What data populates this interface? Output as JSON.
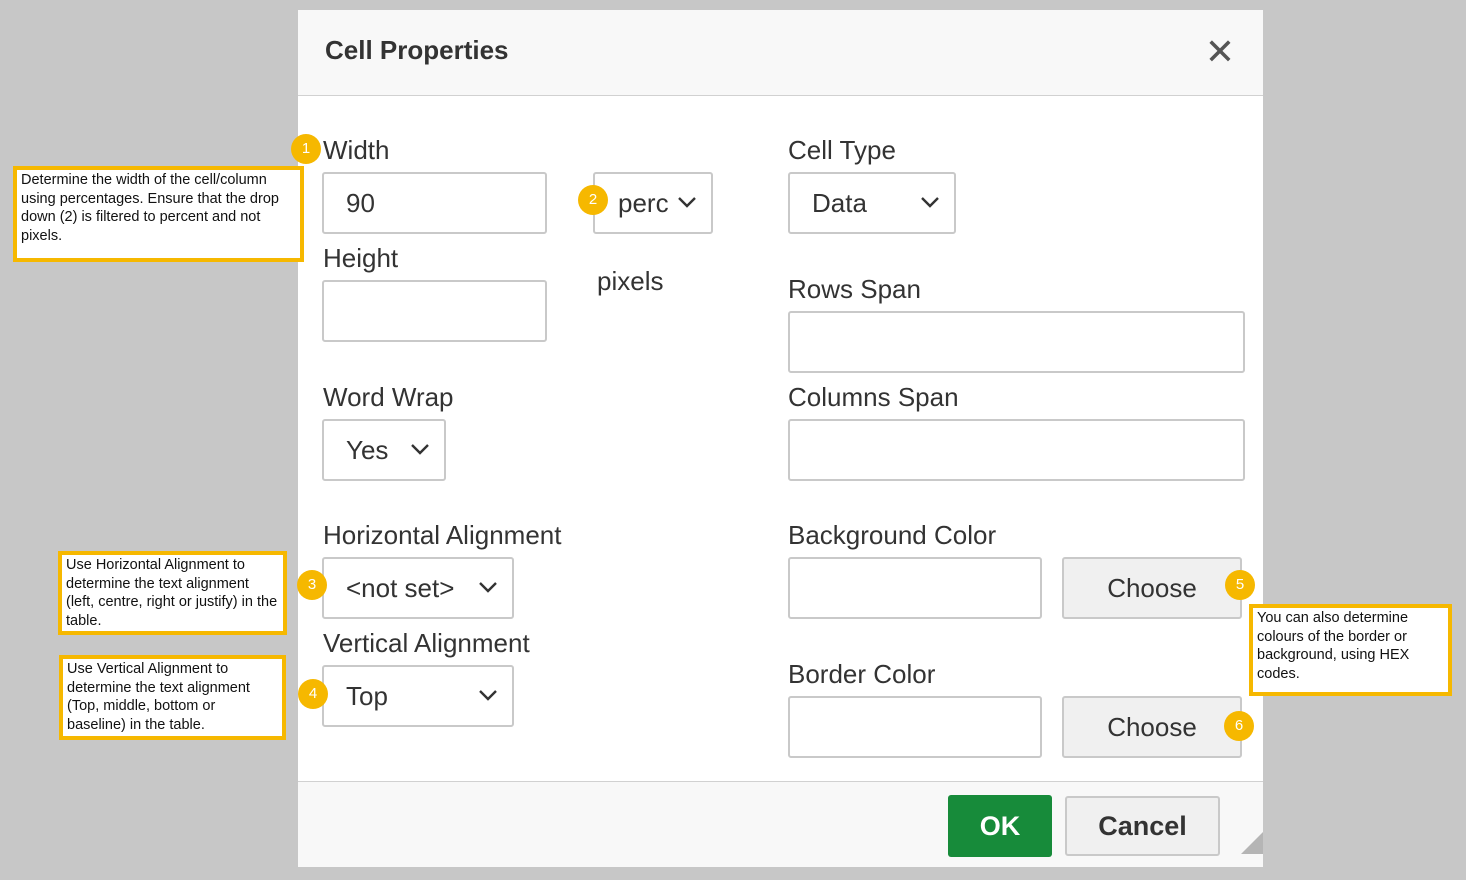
{
  "dialog": {
    "title": "Cell Properties",
    "close_glyph": "✕"
  },
  "fields": {
    "width_label": "Width",
    "width_value": "90",
    "width_unit_value": "perc",
    "height_label": "Height",
    "height_value": "",
    "height_unit": "pixels",
    "word_wrap_label": "Word Wrap",
    "word_wrap_value": "Yes",
    "halign_label": "Horizontal Alignment",
    "halign_value": "<not set>",
    "valign_label": "Vertical Alignment",
    "valign_value": "Top",
    "cell_type_label": "Cell Type",
    "cell_type_value": "Data",
    "rows_span_label": "Rows Span",
    "rows_span_value": "",
    "columns_span_label": "Columns Span",
    "columns_span_value": "",
    "bg_color_label": "Background Color",
    "bg_color_value": "",
    "bg_choose_label": "Choose",
    "border_color_label": "Border Color",
    "border_color_value": "",
    "border_choose_label": "Choose"
  },
  "footer": {
    "ok_label": "OK",
    "cancel_label": "Cancel"
  },
  "annotations": {
    "badges": [
      "1",
      "2",
      "3",
      "4",
      "5",
      "6"
    ],
    "note_width": "Determine the width of the cell/column using percentages. Ensure that the drop down (2) is filtered to percent and not pixels.",
    "note_halign": "Use Horizontal Alignment to determine the text alignment (left, centre, right or justify) in the table.",
    "note_valign": "Use Vertical Alignment to determine the text alignment (Top, middle, bottom or baseline) in the table.",
    "note_color": "You can also determine colours of the border or background, using HEX codes."
  },
  "colors": {
    "ok_green": "#178b3a",
    "annotation_yellow": "#f6b800",
    "backdrop": "#c7c7c7"
  },
  "icons": [
    "close-icon",
    "chevron-down-icon",
    "resize-grip-icon"
  ]
}
